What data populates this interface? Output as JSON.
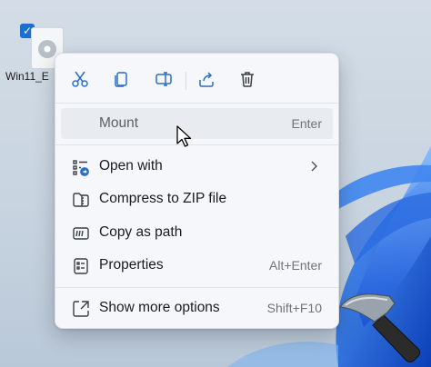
{
  "desktop": {
    "file_icon_label": "Win11_E"
  },
  "context_menu": {
    "toolbar": [
      {
        "icon": "cut-icon"
      },
      {
        "icon": "copy-icon"
      },
      {
        "icon": "rename-icon"
      },
      {
        "icon": "share-icon"
      },
      {
        "icon": "delete-icon"
      }
    ],
    "items": [
      {
        "label": "Mount",
        "shortcut": "Enter",
        "icon": "",
        "state": "hover"
      },
      {
        "label": "Open with",
        "shortcut": "",
        "icon": "open-with-icon",
        "has_submenu": true
      },
      {
        "label": "Compress to ZIP file",
        "shortcut": "",
        "icon": "zip-folder-icon"
      },
      {
        "label": "Copy as path",
        "shortcut": "",
        "icon": "copy-path-icon"
      },
      {
        "label": "Properties",
        "shortcut": "Alt+Enter",
        "icon": "properties-icon"
      },
      {
        "label": "Show more options",
        "shortcut": "Shift+F10",
        "icon": "show-more-options-icon"
      }
    ]
  },
  "colors": {
    "accent": "#1a6fd1",
    "menu_background": "#f5f7fa",
    "hover_background": "#e8ebef"
  }
}
